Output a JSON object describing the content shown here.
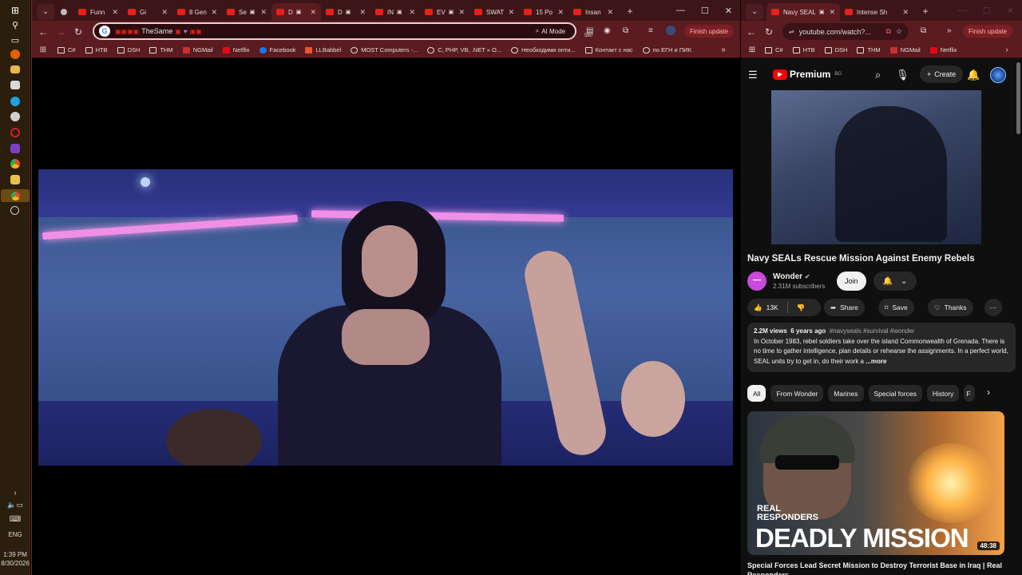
{
  "colors": {
    "tab_bar": "#3d1518",
    "toolbar": "#5a1c20",
    "youtube_red": "#ff0000",
    "finish_update": "#7b1f24"
  },
  "taskbar": {
    "icons": [
      "windows-icon",
      "search-icon",
      "task-view-icon",
      "firefox-icon",
      "files-icon",
      "paint-icon",
      "edge-icon",
      "chrome-beta-icon",
      "opera-icon",
      "onenote-icon",
      "chrome-icon",
      "notes-icon",
      "chrome-active-icon",
      "clock-icon"
    ],
    "lang": "ENG",
    "time": "1:39 PM",
    "date": "8/30/2026"
  },
  "left_browser": {
    "tabs": [
      "Funn",
      "Gi",
      "8 Gen",
      "Se",
      "D",
      "D",
      "IN",
      "EV",
      "SWAT",
      "15 Po",
      "Insan"
    ],
    "active_tab_index": 4,
    "omnibox_text": "TheSame",
    "ai_mode": "AI Mode",
    "badge": "580",
    "finish_update": "Finish update",
    "bookmarks": [
      "C#",
      "HTB",
      "DSH",
      "THM",
      "NGMail",
      "Netflix",
      "Facebook",
      "LLBabbel",
      "MOST Computers -...",
      "C, PHP, VB, .NET » O...",
      "Необходими опти...",
      "Контакт с нас",
      "по ЕГН и ПИК"
    ]
  },
  "right_browser": {
    "tabs": [
      "Navy SEAL",
      "Intense Sh"
    ],
    "url": "youtube.com/watch?...",
    "finish_update": "Finish update",
    "bookmarks": [
      "C#",
      "HTB",
      "DSH",
      "THM",
      "NGMail",
      "Netflix"
    ]
  },
  "youtube": {
    "logo": "Premium",
    "logo_sup": "BG",
    "create": "Create",
    "video_title": "Navy SEALs Rescue Mission Against Enemy Rebels",
    "channel": "Wonder",
    "subscribers": "2.31M subscribers",
    "join": "Join",
    "likes": "13K",
    "share": "Share",
    "save": "Save",
    "thanks": "Thanks",
    "desc_views": "2.2M views",
    "desc_age": "6 years ago",
    "desc_tags": "#navyseals #survival #wonder",
    "desc_text": "In October 1983, rebel soldiers take over the island Commonwealth of Grenada. There is no time to gather intelligence, plan details or rehearse the assignments. In a perfect world, SEAL units try to get in, do their work a",
    "desc_more": "...more",
    "chips": [
      "All",
      "From Wonder",
      "Marines",
      "Special forces",
      "History",
      "F"
    ],
    "next_video": {
      "brand_line1": "REAL",
      "brand_line2": "RESPONDERS",
      "big_text": "DEADLY MISSION",
      "duration": "48:38",
      "title": "Special Forces Lead Secret Mission to Destroy Terrorist Base in Iraq | Real Responders"
    }
  }
}
